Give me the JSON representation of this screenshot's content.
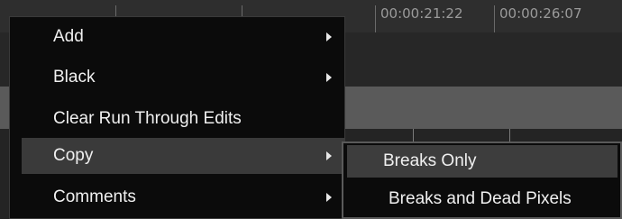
{
  "timeline": {
    "timecodes": [
      "00:00:21:22",
      "00:00:26:07"
    ]
  },
  "context_menu": {
    "items": [
      {
        "label": "Add",
        "has_submenu": true
      },
      {
        "label": "Black",
        "has_submenu": true
      },
      {
        "label": "Clear Run Through Edits",
        "has_submenu": false
      },
      {
        "label": "Copy",
        "has_submenu": true,
        "active": true
      },
      {
        "label": "Comments",
        "has_submenu": true
      }
    ]
  },
  "submenu": {
    "items": [
      {
        "label": "Breaks Only",
        "active": true
      },
      {
        "label": "Breaks and Dead Pixels"
      }
    ]
  },
  "colors": {
    "menu_background": "#0b0b0b",
    "highlight": "#3a3a3a",
    "text": "#f0f0f0"
  }
}
